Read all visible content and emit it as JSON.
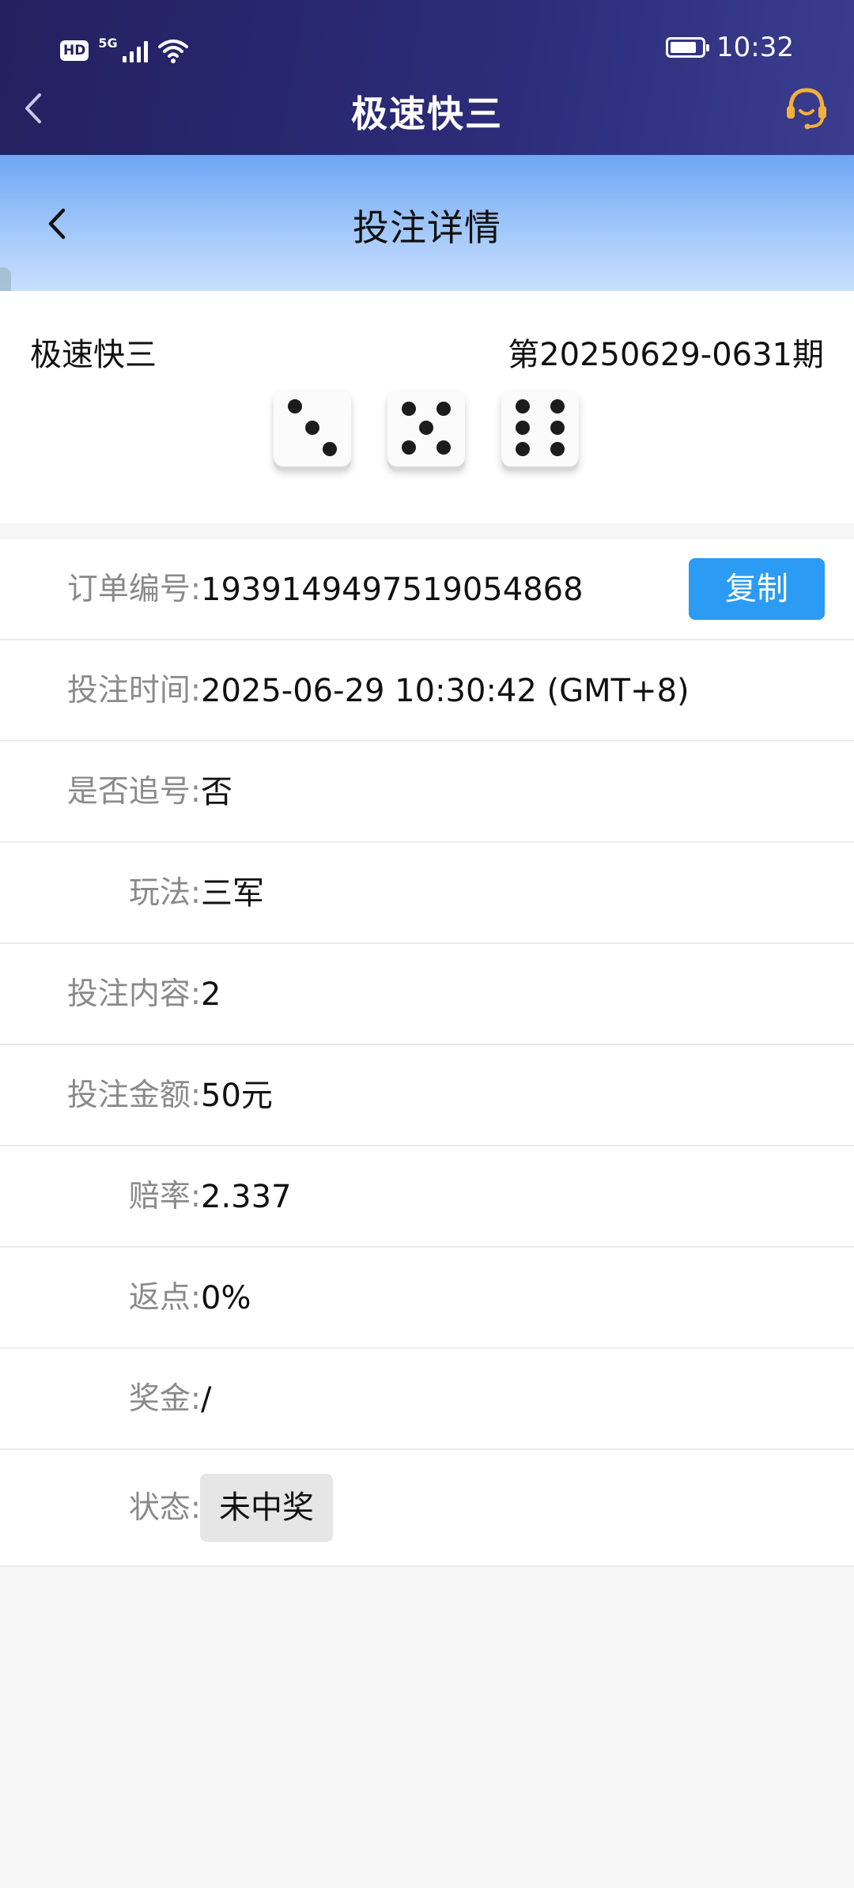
{
  "status_bar": {
    "hd_label": "HD",
    "network_label": "5G",
    "time": "10:32"
  },
  "app_header": {
    "title": "极速快三",
    "back_icon": "back-chevron-icon",
    "support_icon": "customer-service-headset-icon"
  },
  "sub_header": {
    "title": "投注详情",
    "back_icon": "back-chevron-icon"
  },
  "result": {
    "lottery_name": "极速快三",
    "issue": "第20250629-0631期",
    "dice": [
      3,
      5,
      6
    ]
  },
  "details": {
    "order_no": {
      "label": "订单编号:",
      "value": "1939149497519054868",
      "copy_label": "复制"
    },
    "bet_time": {
      "label": "投注时间:",
      "value": "2025-06-29 10:30:42 (GMT+8)"
    },
    "chase": {
      "label": "是否追号:",
      "value": "否"
    },
    "play": {
      "label": "玩法:",
      "value": "三军"
    },
    "content": {
      "label": "投注内容:",
      "value": "2"
    },
    "amount": {
      "label": "投注金额:",
      "value": "50元"
    },
    "odds": {
      "label": "赔率:",
      "value": "2.337"
    },
    "rebate": {
      "label": "返点:",
      "value": "0%"
    },
    "prize": {
      "label": "奖金:",
      "value": "/"
    },
    "status": {
      "label": "状态:",
      "value": "未中奖"
    }
  },
  "colors": {
    "header_navy": "#2c2c7a",
    "subheader_blue": "#6fa6f4",
    "copy_button": "#2b9bf4",
    "support_icon": "#f3b13a"
  }
}
